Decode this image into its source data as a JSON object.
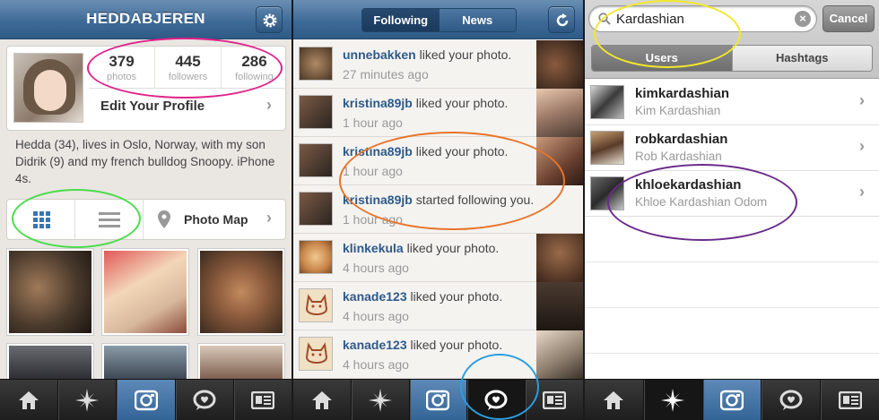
{
  "profile": {
    "title": "HEDDABJEREN",
    "settings_icon": "gear-icon",
    "stats": [
      {
        "num": "379",
        "label": "photos"
      },
      {
        "num": "445",
        "label": "followers"
      },
      {
        "num": "286",
        "label": "following"
      }
    ],
    "edit_label": "Edit Your Profile",
    "bio": "Hedda (34), lives in Oslo, Norway, with my son Didrik (9) and my french bulldog Snoopy. iPhone 4s.",
    "photo_map_label": "Photo Map"
  },
  "news": {
    "tabs": [
      "Following",
      "News"
    ],
    "active_tab": "News",
    "items": [
      {
        "user": "unnebakken",
        "action": " liked your photo.",
        "time": "27 minutes ago"
      },
      {
        "user": "kristina89jb",
        "action": " liked your photo.",
        "time": "1 hour ago"
      },
      {
        "user": "kristina89jb",
        "action": " liked your photo.",
        "time": "1 hour ago"
      },
      {
        "user": "kristina89jb",
        "action": " started following you.",
        "time": "1 hour ago"
      },
      {
        "user": "klinkekula",
        "action": " liked your photo.",
        "time": "4 hours ago"
      },
      {
        "user": "kanade123",
        "action": " liked your photo.",
        "time": "4 hours ago"
      },
      {
        "user": "kanade123",
        "action": " liked your photo.",
        "time": "4 hours ago"
      }
    ]
  },
  "search": {
    "query": "Kardashian",
    "cancel_label": "Cancel",
    "tabs": [
      "Users",
      "Hashtags"
    ],
    "active_tab": "Users",
    "results": [
      {
        "username": "kimkardashian",
        "full_name": "Kim Kardashian"
      },
      {
        "username": "robkardashian",
        "full_name": "Rob Kardashian"
      },
      {
        "username": "khloekardashian",
        "full_name": "Khloe Kardashian Odom"
      }
    ]
  },
  "tabbar": [
    "home-icon",
    "explore-icon",
    "camera-icon",
    "news-icon",
    "profile-icon"
  ],
  "colors": {
    "nav_blue": "#3f6b98",
    "link_blue": "#2d5a8a",
    "ring_pink": "#e0218a",
    "ring_green": "#4cdc4c",
    "ring_orange": "#e8742a",
    "ring_blue": "#2a9ee0",
    "ring_yellow": "#f2e82a",
    "ring_purple": "#6a2a8a"
  }
}
